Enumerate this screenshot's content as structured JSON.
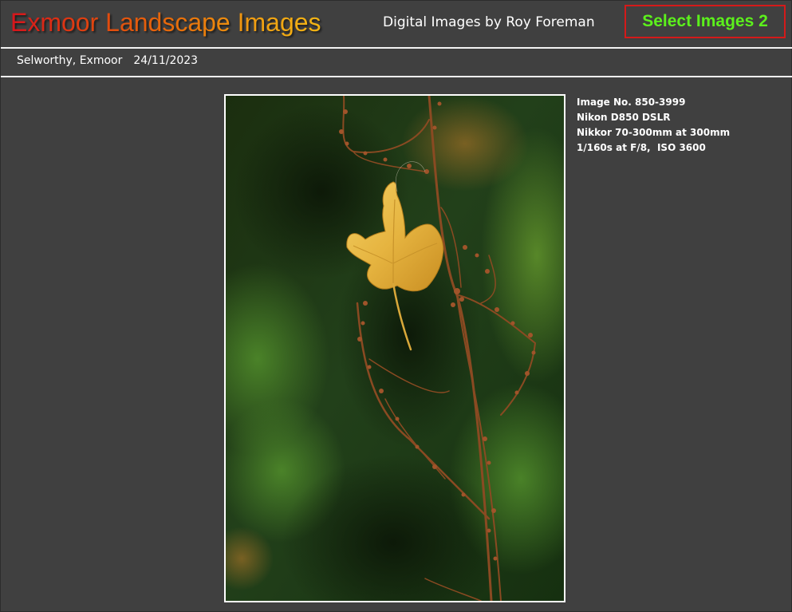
{
  "header": {
    "site_title": "Exmoor Landscape Images",
    "byline": "Digital Images by Roy Foreman",
    "select_button_label": "Select Images 2"
  },
  "location_bar": {
    "location": "Selworthy, Exmoor",
    "date": "24/11/2023"
  },
  "photo": {
    "subject": "Golden leaf caught on dried stems"
  },
  "image_info": {
    "image_number": "Image No. 850-3999",
    "camera": "Nikon D850 DSLR",
    "lens": "Nikkor 70-300mm at 300mm",
    "exposure": "1/160s at F/8,  ISO 3600"
  },
  "colors": {
    "background": "#404040",
    "rule": "#f2f2f2",
    "select_button_text": "#5cf01c",
    "select_button_border": "#d41a1a",
    "title_gradient_start": "#d6141c",
    "title_gradient_end": "#f2b514"
  }
}
